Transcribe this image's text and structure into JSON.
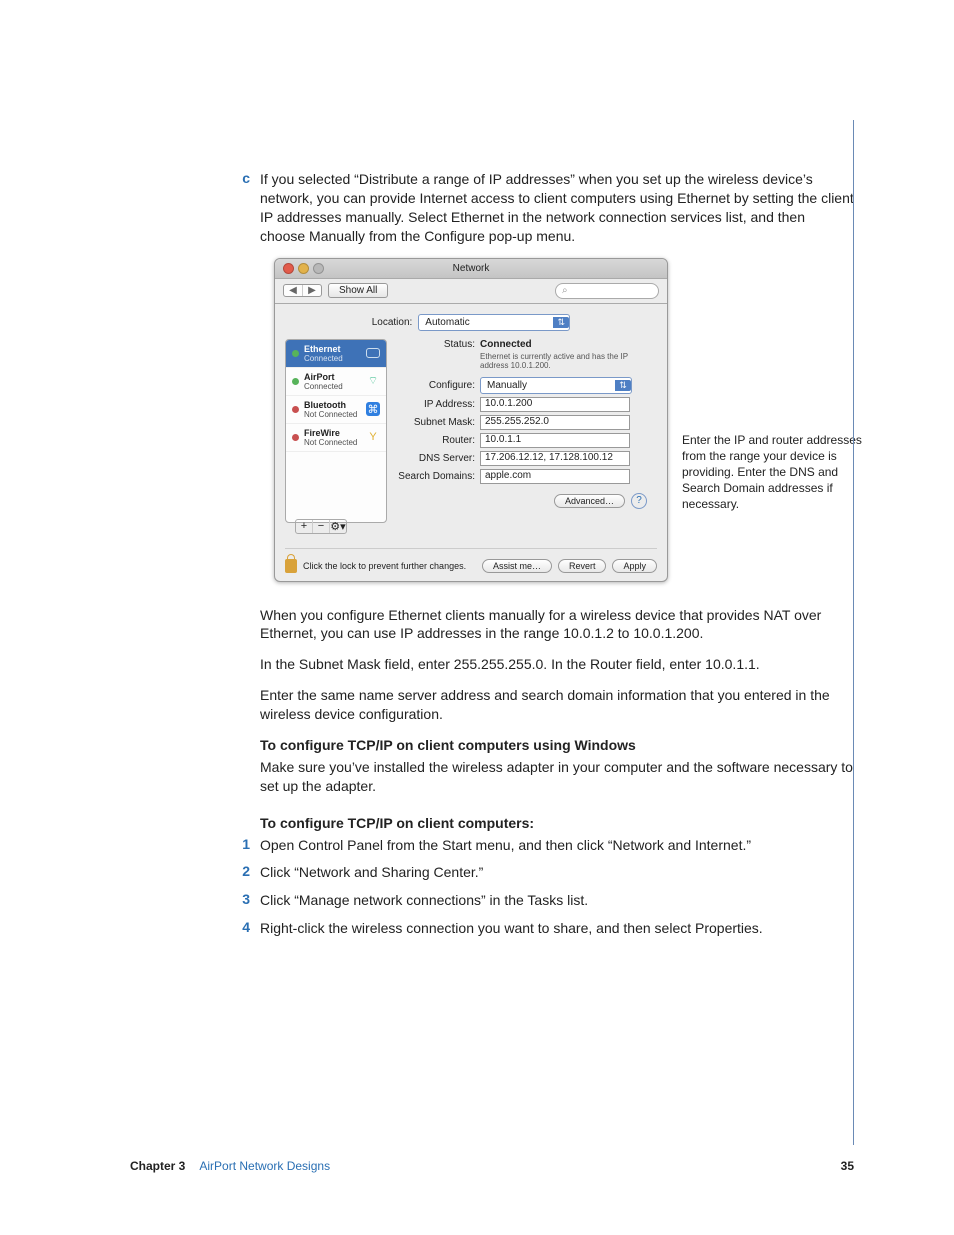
{
  "step_marker": "c",
  "step_text": "If you selected “Distribute a range of IP addresses” when you set up the wireless device’s network, you can provide Internet access to client computers using Ethernet by setting the client IP addresses manually. Select Ethernet in the network connection services list, and then choose Manually from the Configure pop-up menu.",
  "netpane": {
    "window_title": "Network",
    "show_all": "Show All",
    "location_label": "Location:",
    "location_value": "Automatic",
    "services": [
      {
        "name": "Ethernet",
        "status": "Connected",
        "dot": "g",
        "icon": "eth",
        "sel": true
      },
      {
        "name": "AirPort",
        "status": "Connected",
        "dot": "g",
        "icon": "wifi",
        "sel": false
      },
      {
        "name": "Bluetooth",
        "status": "Not Connected",
        "dot": "r",
        "icon": "bt",
        "sel": false
      },
      {
        "name": "FireWire",
        "status": "Not Connected",
        "dot": "r",
        "icon": "fw",
        "sel": false
      }
    ],
    "status_label": "Status:",
    "status_value": "Connected",
    "status_note": "Ethernet is currently active and has the IP address 10.0.1.200.",
    "configure_label": "Configure:",
    "configure_value": "Manually",
    "ip_label": "IP Address:",
    "ip_value": "10.0.1.200",
    "subnet_label": "Subnet Mask:",
    "subnet_value": "255.255.252.0",
    "router_label": "Router:",
    "router_value": "10.0.1.1",
    "dns_label": "DNS Server:",
    "dns_value": "17.206.12.12, 17.128.100.12",
    "search_label": "Search Domains:",
    "search_value": "apple.com",
    "advanced_btn": "Advanced…",
    "listctrl": [
      "+",
      "−",
      "⚙▾"
    ],
    "lock_text": "Click the lock to prevent further changes.",
    "assist_btn": "Assist me…",
    "revert_btn": "Revert",
    "apply_btn": "Apply"
  },
  "annotation": "Enter the IP and router addresses from the range your device is providing. Enter the DNS and Search Domain addresses if necessary.",
  "after_figure": [
    "When you configure Ethernet clients manually for a wireless device that provides NAT over Ethernet, you can use IP addresses in the range 10.0.1.2 to 10.0.1.200.",
    "In the Subnet Mask field, enter 255.255.255.0. In the Router field, enter 10.0.1.1.",
    "Enter the same name server address and search domain information that you entered in the wireless device configuration."
  ],
  "subhead1": "To configure TCP/IP on client computers using Windows",
  "sub1_text": "Make sure you’ve installed the wireless adapter in your computer and the software necessary to set up the adapter.",
  "subhead2": "To configure TCP/IP on client computers:",
  "steps": [
    "Open Control Panel from the Start menu, and then click “Network and Internet.”",
    "Click “Network and Sharing Center.”",
    "Click “Manage network connections” in the Tasks list.",
    "Right-click the wireless connection you want to share, and then select Properties."
  ],
  "footer": {
    "chapter": "Chapter 3",
    "title": "AirPort Network Designs",
    "page": "35"
  }
}
